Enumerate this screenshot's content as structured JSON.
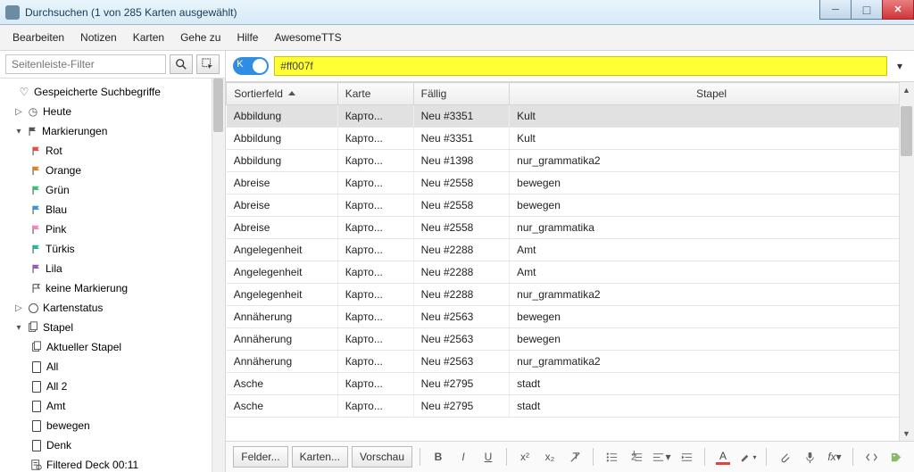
{
  "window": {
    "title": "Durchsuchen (1 von 285 Karten ausgewählt)"
  },
  "menu": [
    "Bearbeiten",
    "Notizen",
    "Karten",
    "Gehe zu",
    "Hilfe",
    "AwesomeTTS"
  ],
  "sidebar": {
    "filter_placeholder": "Seitenleiste-Filter",
    "saved": "Gespeicherte Suchbegriffe",
    "today": "Heute",
    "flags_label": "Markierungen",
    "flags": [
      {
        "label": "Rot",
        "color": "#e74c3c"
      },
      {
        "label": "Orange",
        "color": "#e67e22"
      },
      {
        "label": "Grün",
        "color": "#2ecc71"
      },
      {
        "label": "Blau",
        "color": "#3498db"
      },
      {
        "label": "Pink",
        "color": "#ff7fbf"
      },
      {
        "label": "Türkis",
        "color": "#1abc9c"
      },
      {
        "label": "Lila",
        "color": "#9b59b6"
      },
      {
        "label": "keine Markierung",
        "color": "none"
      }
    ],
    "cardstate": "Kartenstatus",
    "decks_label": "Stapel",
    "decks": [
      {
        "label": "Aktueller Stapel",
        "icon": "stack"
      },
      {
        "label": "All",
        "icon": "card"
      },
      {
        "label": "All 2",
        "icon": "card"
      },
      {
        "label": "Amt",
        "icon": "card"
      },
      {
        "label": "bewegen",
        "icon": "card"
      },
      {
        "label": "Denk",
        "icon": "card"
      },
      {
        "label": "Filtered Deck 00:11",
        "icon": "filter"
      }
    ]
  },
  "search": {
    "toggle_label": "K",
    "value": "#ff007f"
  },
  "table": {
    "columns": [
      "Sortierfeld",
      "Karte",
      "Fällig",
      "Stapel"
    ],
    "widths": [
      110,
      75,
      95,
      400
    ],
    "rows": [
      {
        "sort": "Abbildung",
        "karte": "Карто...",
        "due": "Neu #3351",
        "stapel": "Kult",
        "sel": true
      },
      {
        "sort": "Abbildung",
        "karte": "Карто...",
        "due": "Neu #3351",
        "stapel": "Kult"
      },
      {
        "sort": "Abbildung",
        "karte": "Карто...",
        "due": "Neu #1398",
        "stapel": "nur_grammatika2"
      },
      {
        "sort": "Abreise",
        "karte": "Карто...",
        "due": "Neu #2558",
        "stapel": "bewegen"
      },
      {
        "sort": "Abreise",
        "karte": "Карто...",
        "due": "Neu #2558",
        "stapel": "bewegen"
      },
      {
        "sort": "Abreise",
        "karte": "Карто...",
        "due": "Neu #2558",
        "stapel": "nur_grammatika"
      },
      {
        "sort": "Angelegenheit",
        "karte": "Карто...",
        "due": "Neu #2288",
        "stapel": "Amt"
      },
      {
        "sort": "Angelegenheit",
        "karte": "Карто...",
        "due": "Neu #2288",
        "stapel": "Amt"
      },
      {
        "sort": "Angelegenheit",
        "karte": "Карто...",
        "due": "Neu #2288",
        "stapel": "nur_grammatika2"
      },
      {
        "sort": "Annäherung",
        "karte": "Карто...",
        "due": "Neu #2563",
        "stapel": "bewegen"
      },
      {
        "sort": "Annäherung",
        "karte": "Карто...",
        "due": "Neu #2563",
        "stapel": "bewegen"
      },
      {
        "sort": "Annäherung",
        "karte": "Карто...",
        "due": "Neu #2563",
        "stapel": "nur_grammatika2"
      },
      {
        "sort": "Asche",
        "karte": "Карто...",
        "due": "Neu #2795",
        "stapel": "stadt"
      },
      {
        "sort": "Asche",
        "karte": "Карто...",
        "due": "Neu #2795",
        "stapel": "stadt"
      }
    ]
  },
  "toolbar": {
    "fields": "Felder...",
    "cards": "Karten...",
    "preview": "Vorschau"
  }
}
